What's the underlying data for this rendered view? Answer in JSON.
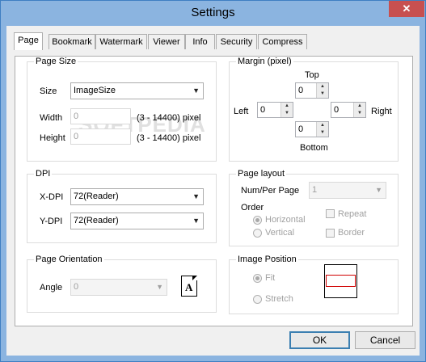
{
  "window": {
    "title": "Settings",
    "close_glyph": "✕"
  },
  "tabs": [
    {
      "label": "Page"
    },
    {
      "label": "Bookmark"
    },
    {
      "label": "Watermark"
    },
    {
      "label": "Viewer"
    },
    {
      "label": "Info"
    },
    {
      "label": "Security"
    },
    {
      "label": "Compress"
    }
  ],
  "page_size": {
    "label": "Page Size",
    "size_label": "Size",
    "size_value": "ImageSize",
    "width_label": "Width",
    "width_value": "0",
    "width_range": "(3 - 14400) pixel",
    "height_label": "Height",
    "height_value": "0",
    "height_range": "(3 - 14400) pixel"
  },
  "margin": {
    "label": "Margin (pixel)",
    "top_label": "Top",
    "top_value": "0",
    "left_label": "Left",
    "left_value": "0",
    "right_label": "Right",
    "right_value": "0",
    "bottom_label": "Bottom",
    "bottom_value": "0"
  },
  "dpi": {
    "label": "DPI",
    "xdpi_label": "X-DPI",
    "xdpi_value": "72(Reader)",
    "ydpi_label": "Y-DPI",
    "ydpi_value": "72(Reader)"
  },
  "page_layout": {
    "label": "Page layout",
    "num_label": "Num/Per Page",
    "num_value": "1",
    "order_label": "Order",
    "horizontal_label": "Horizontal",
    "horizontal_checked": true,
    "vertical_label": "Vertical",
    "repeat_label": "Repeat",
    "border_label": "Border"
  },
  "orientation": {
    "label": "Page Orientation",
    "angle_label": "Angle",
    "angle_value": "0",
    "page_letter": "A"
  },
  "image_position": {
    "label": "Image Position",
    "fit_label": "Fit",
    "fit_checked": true,
    "stretch_label": "Stretch"
  },
  "buttons": {
    "ok": "OK",
    "cancel": "Cancel"
  },
  "watermark_text": "SOFTPEDIA"
}
